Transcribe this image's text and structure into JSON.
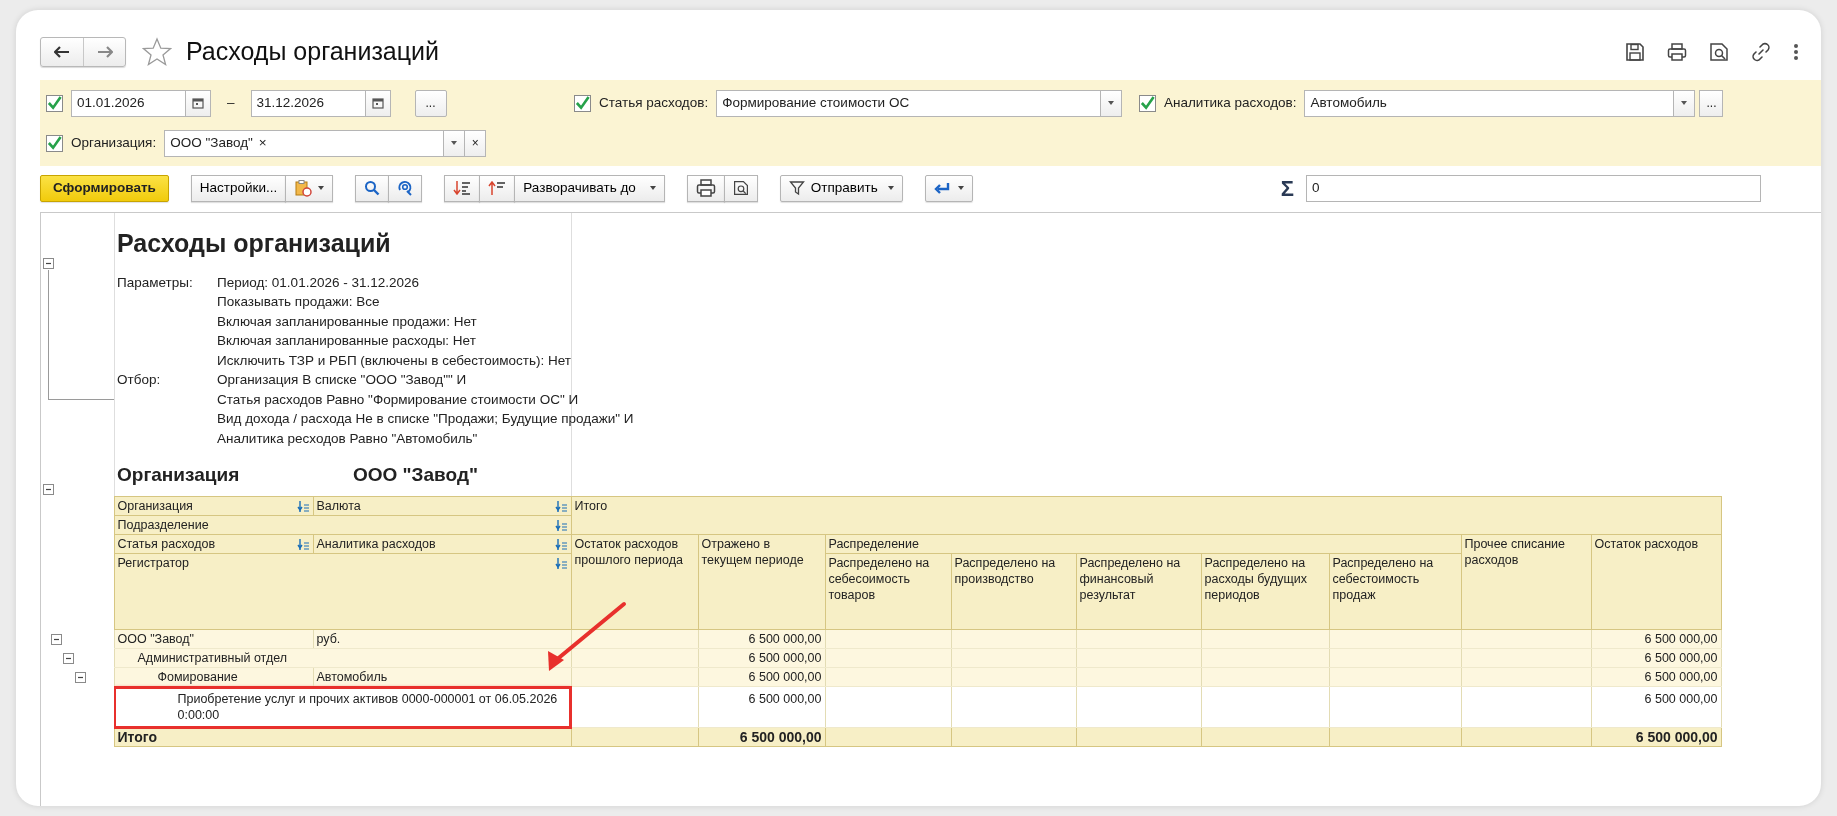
{
  "window": {
    "title": "Расходы организаций",
    "favorite": false
  },
  "filters": [
    [
      {
        "kind": "period",
        "checked": true,
        "from": "01.01.2026",
        "separator": "–",
        "to": "31.12.2026",
        "more": "..."
      },
      {
        "kind": "select",
        "checked": true,
        "label": "Статья расходов:",
        "value": "Формирование стоимости ОС"
      },
      {
        "kind": "select",
        "checked": true,
        "label": "Аналитика расходов:",
        "value": "Автомобиль",
        "more": "..."
      }
    ],
    [
      {
        "kind": "tags",
        "checked": true,
        "label": "Организация:",
        "tags": [
          {
            "text": "ООО \"Завод\"",
            "remove": "×"
          }
        ],
        "clear": "×"
      }
    ]
  ],
  "toolbar": [
    {
      "kind": "primary",
      "label": "Сформировать"
    },
    {
      "kind": "settings",
      "label": "Настройки..."
    },
    {
      "kind": "search"
    },
    {
      "kind": "expand",
      "label": "Разворачивать до"
    },
    {
      "kind": "print"
    },
    {
      "kind": "send",
      "label": "Отправить"
    },
    {
      "kind": "undo"
    }
  ],
  "sum": {
    "symbol": "Σ",
    "value": "0"
  },
  "report": {
    "header": {
      "expanded": true,
      "title": "Расходы организаций",
      "parameters": [
        {
          "label": "Параметры:",
          "lines": [
            "Период: 01.01.2026 - 31.12.2026",
            "Показывать продажи: Все",
            "Включая запланированные продажи: Нет",
            "Включая запланированные расходы: Нет",
            "Исключить ТЗР и РБП (включены в себестоимость): Нет"
          ]
        },
        {
          "label": "Отбор:",
          "lines": [
            "Организация В списке \"ООО \"Завод\"\" И",
            "Статья расходов Равно \"Формирование стоимости ОС\" И",
            "Вид дохода / расхода Не в списке \"Продажи; Будущие продажи\" И",
            "Аналитика ресходов Равно \"Автомобиль\""
          ]
        }
      ]
    },
    "grouping": {
      "expanded": true,
      "label": "Организация",
      "value": "ООО \"Завод\""
    },
    "table": {
      "dimension_headers": [
        [
          "Организация",
          "Валюта"
        ],
        [
          "Подразделение"
        ],
        [
          "Статья расходов",
          "Аналитика расходов"
        ],
        [
          "Регистратор"
        ]
      ],
      "total_header": "Итого",
      "columns": [
        {
          "title": "Остаток расходов прошлого периода"
        },
        {
          "title": "Отражено в текущем периоде"
        },
        {
          "group": "Распределение",
          "columns": [
            "Распределено на себесоимость товаров",
            "Распределено на производство",
            "Распределено на финансовый результат",
            "Распределено на расходы будущих периодов",
            "Распределено на себестоимость продаж"
          ]
        },
        {
          "title": "Прочее списание расходов"
        },
        {
          "title": "Остаток расходов"
        }
      ],
      "rows": [
        {
          "kind": "group",
          "expanded": true,
          "highlighted": false,
          "dims": [
            "ООО \"Завод\"",
            "руб."
          ],
          "reflected": "6 500 000,00",
          "closing_balance": "6 500 000,00",
          "children": [
            {
              "kind": "group",
              "expanded": true,
              "highlighted": false,
              "dims": [
                "Административный отдел"
              ],
              "reflected": "6 500 000,00",
              "closing_balance": "6 500 000,00",
              "children": [
                {
                  "kind": "group",
                  "expanded": true,
                  "highlighted": false,
                  "dims": [
                    "Фомирование",
                    "Автомобиль"
                  ],
                  "reflected": "6 500 000,00",
                  "closing_balance": "6 500 000,00",
                  "children": [
                    {
                      "kind": "detail",
                      "highlighted": true,
                      "dims": [
                        "Приобретение услуг и прочих активов 0000-000001 от 06.05.2026 0:00:00"
                      ],
                      "reflected": "6 500 000,00",
                      "closing_balance": "6 500 000,00"
                    }
                  ]
                }
              ]
            }
          ]
        }
      ],
      "total": {
        "label": "Итого",
        "reflected": "6 500 000,00",
        "closing_balance": "6 500 000,00"
      }
    },
    "annotation": {
      "kind": "arrow"
    }
  }
}
